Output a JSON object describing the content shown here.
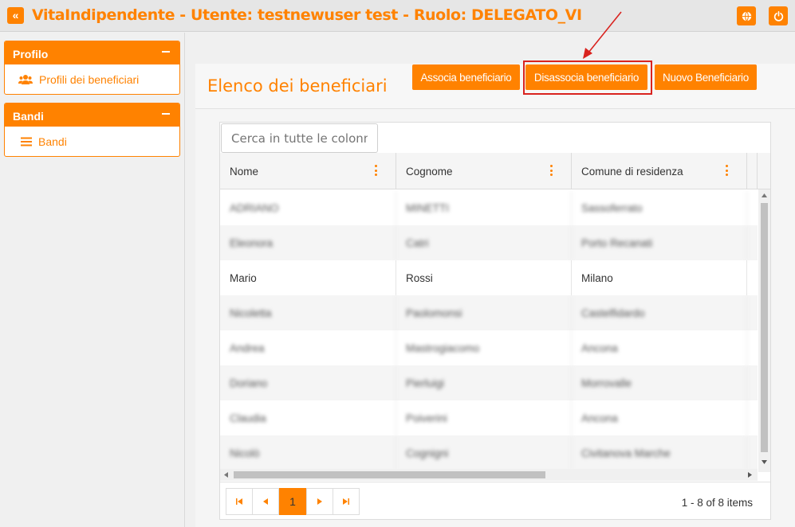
{
  "app": {
    "title": "VitaIndipendente - Utente: testnewuser test - Ruolo: DELEGATO_VI",
    "collapse_glyph": "«",
    "accent_color": "#ff8200"
  },
  "topbar": {
    "icons": [
      "globe-icon",
      "power-icon"
    ]
  },
  "sidebar": {
    "panels": [
      {
        "title": "Profilo",
        "items": [
          {
            "label": "Profili dei beneficiari",
            "icon": "users-icon"
          }
        ]
      },
      {
        "title": "Bandi",
        "items": [
          {
            "label": "Bandi",
            "icon": "list-icon"
          }
        ]
      }
    ]
  },
  "main": {
    "title": "Elenco dei beneficiari",
    "buttons": {
      "associa": "Associa beneficiario",
      "disassocia": "Disassocia beneficiario",
      "nuovo": "Nuovo Beneficiario"
    },
    "highlight_color": "#d9231f"
  },
  "grid": {
    "search_placeholder": "Cerca in tutte le colonne",
    "columns": [
      "Nome",
      "Cognome",
      "Comune di residenza"
    ],
    "rows": [
      {
        "nome": "ADRIANO",
        "cognome": "MINETTI",
        "comune": "Sassoferrato",
        "blurred": true
      },
      {
        "nome": "Eleonora",
        "cognome": "Catri",
        "comune": "Porto Recanati",
        "blurred": true
      },
      {
        "nome": "Mario",
        "cognome": "Rossi",
        "comune": "Milano",
        "blurred": false
      },
      {
        "nome": "Nicoletta",
        "cognome": "Paolomonsi",
        "comune": "Castelfidardo",
        "blurred": true
      },
      {
        "nome": "Andrea",
        "cognome": "Mastrogiacomo",
        "comune": "Ancona",
        "blurred": true
      },
      {
        "nome": "Doriano",
        "cognome": "Pierluigi",
        "comune": "Morrovalle",
        "blurred": true
      },
      {
        "nome": "Claudia",
        "cognome": "Poiverini",
        "comune": "Ancona",
        "blurred": true
      },
      {
        "nome": "Nicolò",
        "cognome": "Cognigni",
        "comune": "Civitanova Marche",
        "blurred": true
      }
    ],
    "pager": {
      "current_page": "1",
      "info": "1 - 8 of 8 items"
    }
  }
}
